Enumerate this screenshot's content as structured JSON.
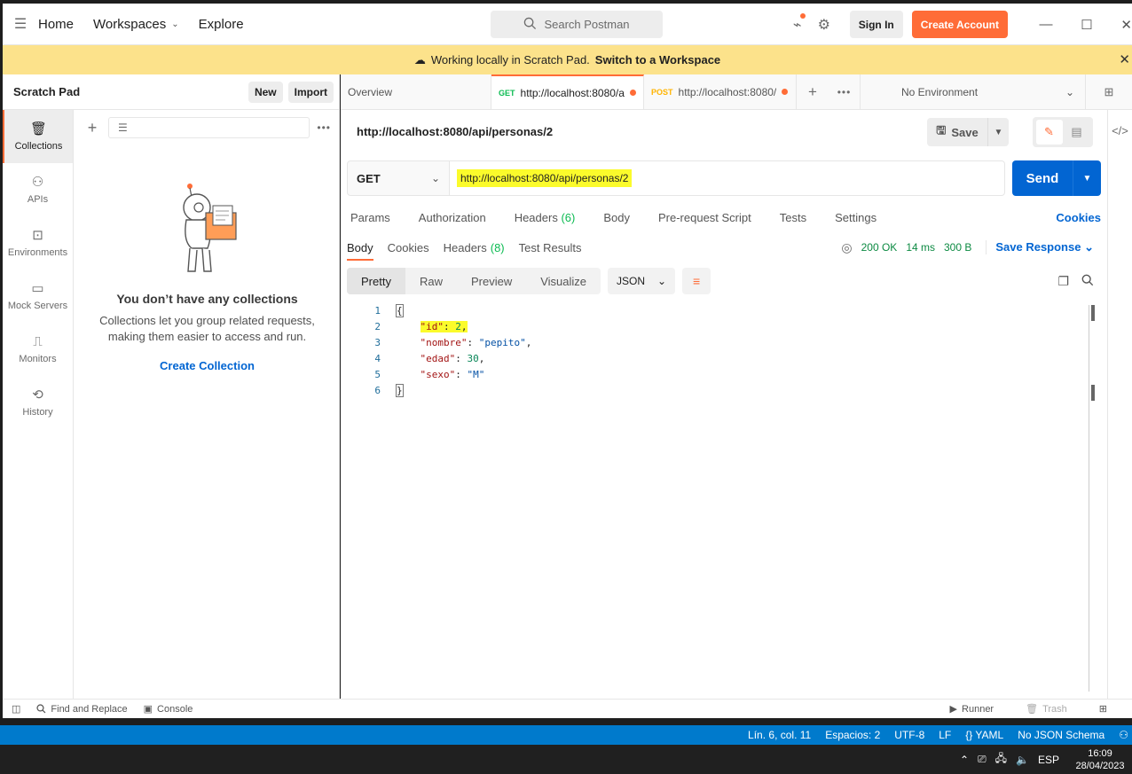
{
  "header": {
    "nav": [
      "Home",
      "Workspaces",
      "Explore"
    ],
    "search_placeholder": "Search Postman",
    "sign_in": "Sign In",
    "create_account": "Create Account"
  },
  "banner": {
    "text": "Working locally in Scratch Pad.",
    "link": "Switch to a Workspace"
  },
  "left_panel": {
    "title": "Scratch Pad",
    "new_label": "New",
    "import_label": "Import",
    "sidebar": [
      {
        "label": "Collections",
        "icon": "trash-can-icon",
        "active": true
      },
      {
        "label": "APIs",
        "icon": "api-icon"
      },
      {
        "label": "Environments",
        "icon": "environment-icon"
      },
      {
        "label": "Mock Servers",
        "icon": "server-icon"
      },
      {
        "label": "Monitors",
        "icon": "monitor-icon"
      },
      {
        "label": "History",
        "icon": "history-icon"
      }
    ],
    "empty_title": "You don’t have any collections",
    "empty_desc": "Collections let you group related requests, making them easier to access and run.",
    "empty_link": "Create Collection"
  },
  "tabs": {
    "overview": "Overview",
    "tab1": {
      "method": "GET",
      "url": "http://localhost:8080/a"
    },
    "tab2": {
      "method": "POST",
      "url": "http://localhost:8080/"
    },
    "environment": "No Environment"
  },
  "request": {
    "title": "http://localhost:8080/api/personas/2",
    "save_label": "Save",
    "method": "GET",
    "url": "http://localhost:8080/api/personas/2",
    "send_label": "Send",
    "tabs": [
      "Params",
      "Authorization",
      "Headers",
      "Body",
      "Pre-request Script",
      "Tests",
      "Settings"
    ],
    "headers_count": "(6)",
    "cookies_label": "Cookies"
  },
  "response": {
    "tabs": [
      "Body",
      "Cookies",
      "Headers",
      "Test Results"
    ],
    "headers_count": "(8)",
    "status": "200 OK",
    "time": "14 ms",
    "size": "300 B",
    "save_response": "Save Response",
    "views": [
      "Pretty",
      "Raw",
      "Preview",
      "Visualize"
    ],
    "format": "JSON",
    "lines": [
      "1",
      "2",
      "3",
      "4",
      "5",
      "6"
    ],
    "body": {
      "open": "{",
      "id_key": "\"id\"",
      "id_val": "2",
      "nombre_key": "\"nombre\"",
      "nombre_val": "\"pepito\"",
      "edad_key": "\"edad\"",
      "edad_val": "30",
      "sexo_key": "\"sexo\"",
      "sexo_val": "\"M\"",
      "close": "}"
    }
  },
  "footer": {
    "find_replace": "Find and Replace",
    "console": "Console",
    "runner": "Runner",
    "trash": "Trash"
  },
  "vscode_status": [
    "Lín. 6, col. 11",
    "Espacios: 2",
    "UTF-8",
    "LF",
    "{} YAML",
    "No JSON Schema"
  ],
  "taskbar": {
    "lang": "ESP",
    "time": "16:09",
    "date": "28/04/2023"
  },
  "colors": {
    "accent": "#ff6c37",
    "send_blue": "#0265d2",
    "banner": "#fce28b",
    "highlight": "#fbfb2b",
    "status_bar": "#007acc"
  }
}
